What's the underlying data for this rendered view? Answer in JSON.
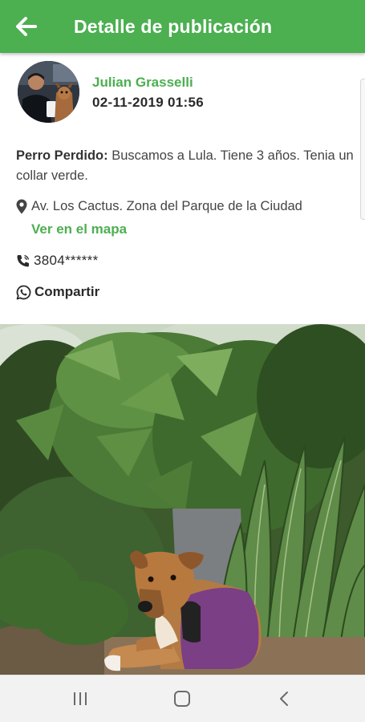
{
  "appbar": {
    "title": "Detalle de publicación",
    "back_icon": "arrow-left-icon"
  },
  "post": {
    "author": "Julian Grasselli",
    "date": "02-11-2019 01:56",
    "category": "Perro Perdido:",
    "description": " Buscamos a Lula. Tiene 3 años. Tenia un collar verde.",
    "location": "Av. Los Cactus. Zona del Parque de la Ciudad",
    "map_link": "Ver en el mapa",
    "phone": "3804******",
    "share_label": "Compartir"
  },
  "icons": {
    "location": "map-marker-icon",
    "phone": "phone-icon",
    "share": "whatsapp-icon"
  },
  "navbar": {
    "recents_icon": "recents-icon",
    "home_icon": "home-icon",
    "back_icon": "back-chevron-icon"
  },
  "colors": {
    "primary": "#4caf50",
    "text_dark": "#2a2a2a",
    "text_body": "#444444",
    "nav_bg": "#f2f2f2"
  }
}
